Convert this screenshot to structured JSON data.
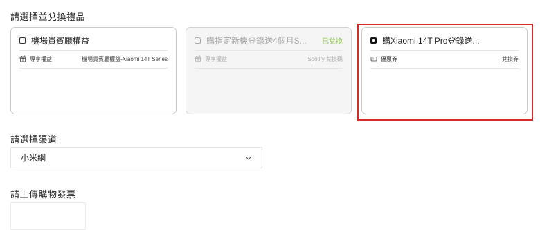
{
  "gift_section": {
    "title": "請選擇並兌換禮品"
  },
  "cards": [
    {
      "title": "機場貴賓廳權益",
      "status": "",
      "row_label": "專享權益",
      "row_value": "機場貴賓廳權益-Xiaomi 14T Series",
      "row_icon": "gift-icon",
      "selected": false,
      "disabled": false
    },
    {
      "title": "購指定新機登錄送4個月S...",
      "status": "已兌換",
      "row_label": "專享權益",
      "row_value": "Spotify 兌換碼",
      "row_icon": "gift-icon",
      "selected": false,
      "disabled": true
    },
    {
      "title": "購Xiaomi 14T Pro登錄送...",
      "status": "",
      "row_label": "優惠券",
      "row_value": "兌換券",
      "row_icon": "coupon-icon",
      "selected": true,
      "disabled": false
    }
  ],
  "channel_section": {
    "title": "請選擇渠道",
    "selected_value": "小米網"
  },
  "invoice_section": {
    "title": "請上傳購物發票"
  },
  "colors": {
    "highlight": "#d62b2b",
    "redeemed_status": "#8bc34a"
  }
}
